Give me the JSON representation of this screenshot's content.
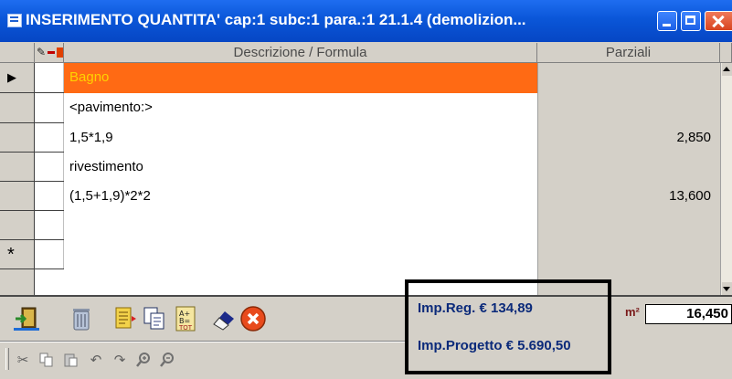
{
  "window": {
    "title": "INSERIMENTO QUANTITA' cap:1 subc:1 para.:1    21.1.4  (demolizion..."
  },
  "grid": {
    "columns": {
      "description": "Descrizione / Formula",
      "partials": "Parziali"
    },
    "rows": [
      {
        "text": "Bagno",
        "value": ""
      },
      {
        "text": "<pavimento:>",
        "value": ""
      },
      {
        "text": "1,5*1,9",
        "value": "2,850"
      },
      {
        "text": "rivestimento",
        "value": ""
      },
      {
        "text": "(1,5+1,9)*2*2",
        "value": "13,600"
      }
    ],
    "new_row_marker": "*",
    "current_row_marker": "▶"
  },
  "summary": {
    "imp_reg": "Imp.Reg. € 134,89",
    "imp_progetto": "Imp.Progetto € 5.690,50",
    "unit": "m²",
    "total": "16,450"
  },
  "colors": {
    "title_bar": "#0a56d8",
    "selected_row": "#ff6a14",
    "selected_text": "#ffd200",
    "summary_text": "#0b2a7a"
  },
  "toolbar": {
    "main_icons": [
      "exit-icon",
      "trash-icon",
      "document-icon",
      "copy-pages-icon",
      "calculator-icon",
      "eraser-icon",
      "cancel-icon"
    ],
    "edit_icons": [
      "cut-icon",
      "copy-icon",
      "paste-icon",
      "undo-icon",
      "redo-icon",
      "zoom-in-icon",
      "zoom-out-icon"
    ]
  }
}
